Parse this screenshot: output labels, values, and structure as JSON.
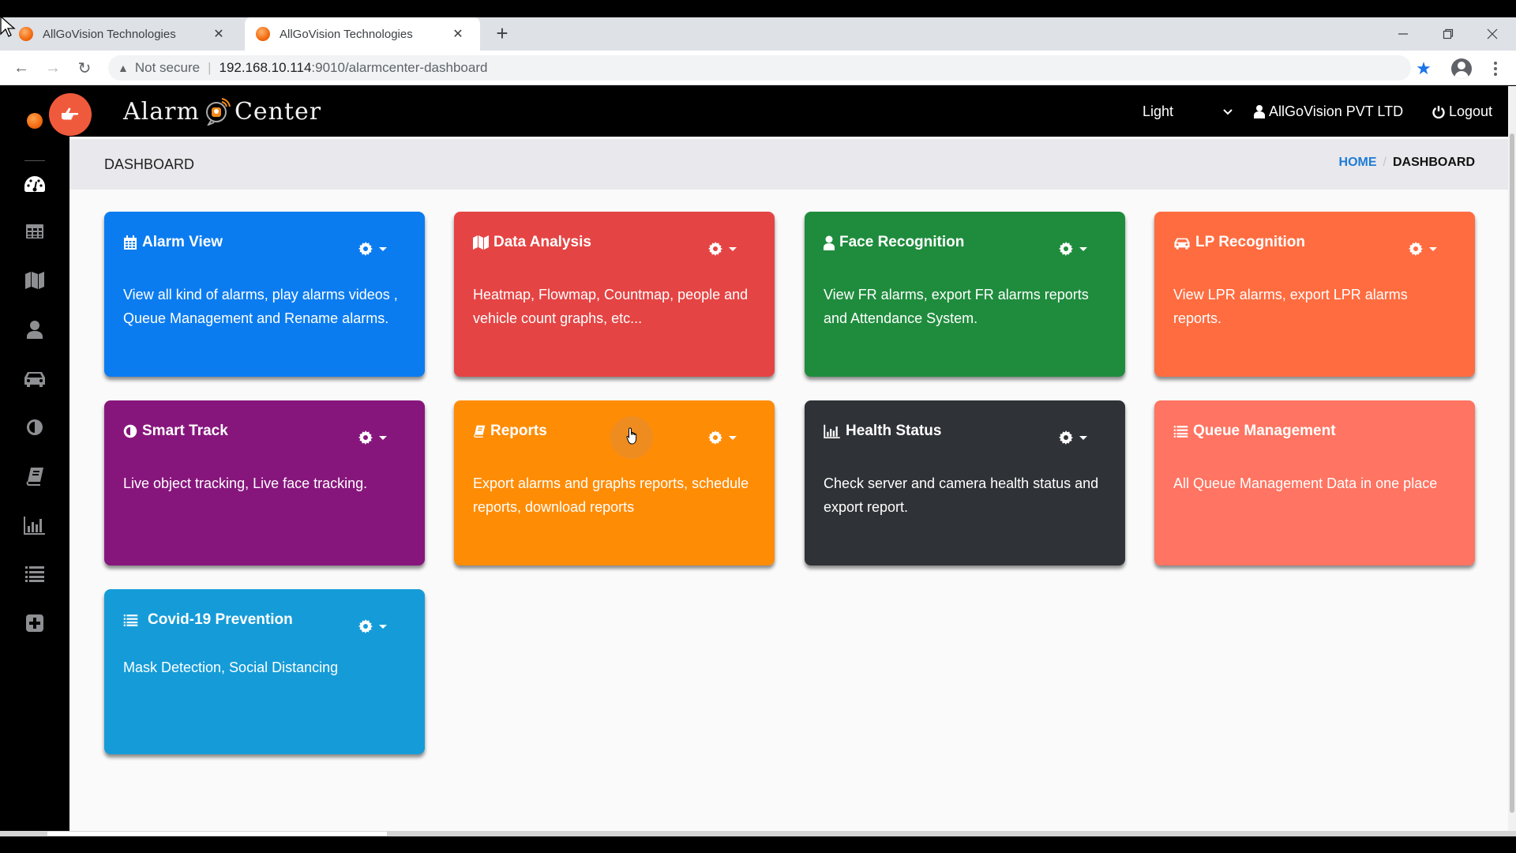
{
  "browser": {
    "tabs": [
      {
        "title": "AllGoVision Technologies",
        "active": false
      },
      {
        "title": "AllGoVision Technologies",
        "active": true
      }
    ],
    "new_tab_label": "+",
    "address": {
      "security_label": "Not secure",
      "host": "192.168.10.114",
      "path": ":9010/alarmcenter-dashboard"
    }
  },
  "app": {
    "logo_left": "Alarm",
    "logo_right": "Center",
    "theme_select": {
      "selected": "Light"
    },
    "user_name": "AllGoVision PVT LTD",
    "logout_label": "Logout"
  },
  "sidebar": {
    "items": [
      {
        "name": "dashboard",
        "icon": "tachometer-icon",
        "active": true
      },
      {
        "name": "alarm-view",
        "icon": "table-icon",
        "active": false
      },
      {
        "name": "data-analysis",
        "icon": "map-icon",
        "active": false
      },
      {
        "name": "face-recognition",
        "icon": "user-icon",
        "active": false
      },
      {
        "name": "lp-recognition",
        "icon": "car-icon",
        "active": false
      },
      {
        "name": "smart-track",
        "icon": "adjust-icon",
        "active": false
      },
      {
        "name": "reports",
        "icon": "book-icon",
        "active": false
      },
      {
        "name": "health-status",
        "icon": "bar-chart-icon",
        "active": false
      },
      {
        "name": "queue-management",
        "icon": "list-icon",
        "active": false
      },
      {
        "name": "covid-prevention",
        "icon": "plus-square-icon",
        "active": false
      }
    ]
  },
  "page": {
    "title": "DASHBOARD",
    "breadcrumb": {
      "home": "HOME",
      "separator": "/",
      "current": "DASHBOARD"
    }
  },
  "cards": [
    {
      "title": "Alarm View",
      "icon": "calendar-icon",
      "color": "#0b7cf0",
      "has_settings": true,
      "description": "View all kind of alarms, play alarms videos , Queue Management and Rename alarms."
    },
    {
      "title": "Data Analysis",
      "icon": "map-icon",
      "color": "#e54444",
      "has_settings": true,
      "description": "Heatmap, Flowmap, Countmap, people and vehicle count graphs, etc..."
    },
    {
      "title": "Face Recognition",
      "icon": "user-icon",
      "color": "#1f8c3d",
      "has_settings": true,
      "description": "View FR alarms, export FR alarms reports and Attendance System."
    },
    {
      "title": "LP Recognition",
      "icon": "car-icon",
      "color": "#ff6c40",
      "has_settings": true,
      "description": "View LPR alarms, export LPR alarms reports."
    },
    {
      "title": "Smart Track",
      "icon": "adjust-icon",
      "color": "#87167c",
      "has_settings": true,
      "description": "Live object tracking, Live face tracking."
    },
    {
      "title": "Reports",
      "icon": "book-icon",
      "color": "#ff8c05",
      "has_settings": true,
      "description": "Export alarms and graphs reports, schedule reports, download reports"
    },
    {
      "title": "Health Status",
      "icon": "bar-chart-icon",
      "color": "#2f3236",
      "has_settings": true,
      "description": "Check server and camera health status and export report."
    },
    {
      "title": "Queue Management",
      "icon": "list-icon",
      "color": "#ff7462",
      "has_settings": false,
      "description": "All Queue Management Data in one place"
    },
    {
      "title": "Covid-19 Prevention",
      "icon": "list-icon",
      "color": "#159cd8",
      "has_settings": true,
      "description": "Mask Detection, Social Distancing"
    }
  ]
}
